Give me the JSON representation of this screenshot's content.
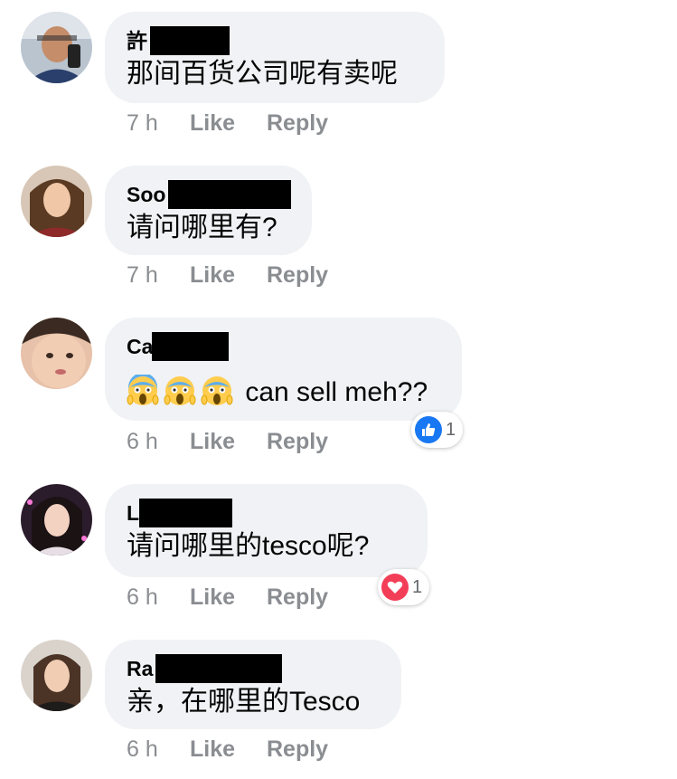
{
  "comments": [
    {
      "name": "許",
      "text": "那间百货公司呢有卖呢",
      "time": "7 h",
      "like": "Like",
      "reply": "Reply"
    },
    {
      "name": "Soo",
      "text": "请问哪里有?",
      "time": "7 h",
      "like": "Like",
      "reply": "Reply"
    },
    {
      "name": "Ca",
      "text": "can sell meh??",
      "emoji": "screaming-face-icon",
      "emoji_count": 3,
      "time": "6 h",
      "like": "Like",
      "reply": "Reply",
      "reaction": {
        "icon": "thumbs-up-icon",
        "count": "1",
        "color": "#1877f2"
      }
    },
    {
      "name": "L",
      "text": "请问哪里的tesco呢?",
      "time": "6 h",
      "like": "Like",
      "reply": "Reply",
      "reaction": {
        "icon": "heart-icon",
        "count": "1",
        "color": "#f33e58"
      }
    },
    {
      "name": "Ra",
      "text": "亲，在哪里的Tesco",
      "time": "6 h",
      "like": "Like",
      "reply": "Reply"
    }
  ],
  "colors": {
    "bubble": "#f0f2f5",
    "meta": "#8a8d91",
    "redaction": "#000000"
  }
}
